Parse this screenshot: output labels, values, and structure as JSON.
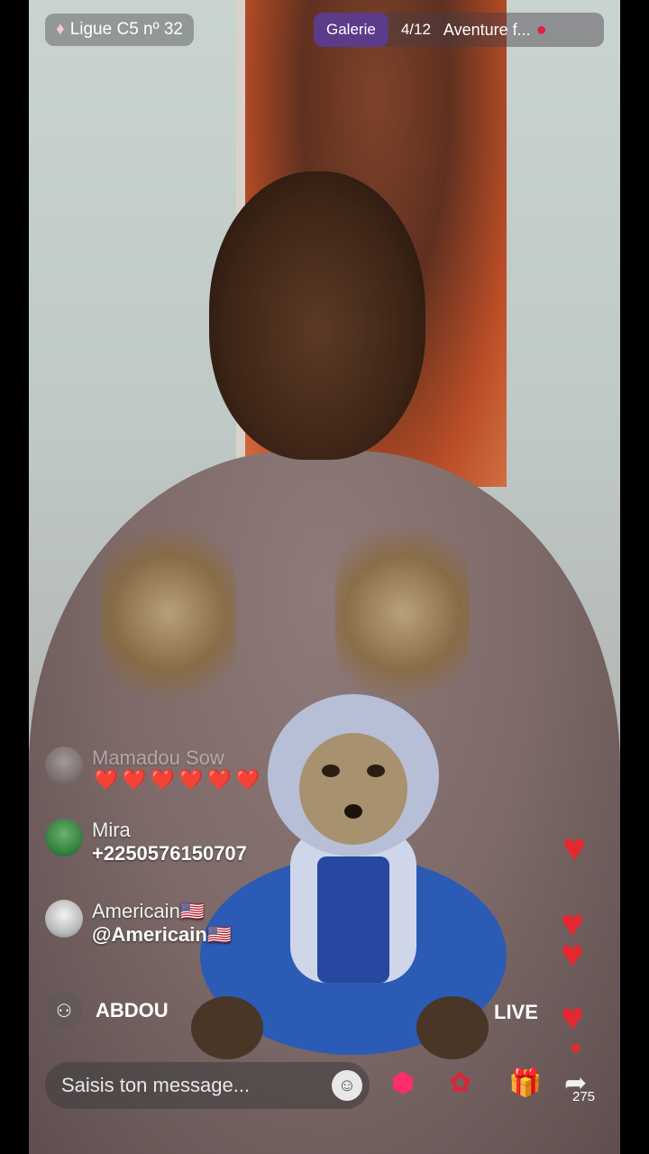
{
  "top": {
    "league_label": "Ligue C5 nº 32",
    "gallery_tab": "Galerie",
    "page_counter": "4/12",
    "adventure_tab": "Aventure f..."
  },
  "comments": [
    {
      "name": "Mamadou Sow",
      "text": "❤️❤️❤️❤️❤️❤️"
    },
    {
      "name": "Mira",
      "text": "+2250576150707"
    },
    {
      "name": "Americain🇺🇸",
      "text": "@Americain🇺🇸"
    }
  ],
  "join_notice": {
    "name": "ABDOU",
    "suffix": "LIVE"
  },
  "bottom_bar": {
    "message_placeholder": "Saisis ton message...",
    "share_count": "275"
  },
  "colors": {
    "accent_purple": "#5a3c8a",
    "heart_red": "#e5282f"
  }
}
